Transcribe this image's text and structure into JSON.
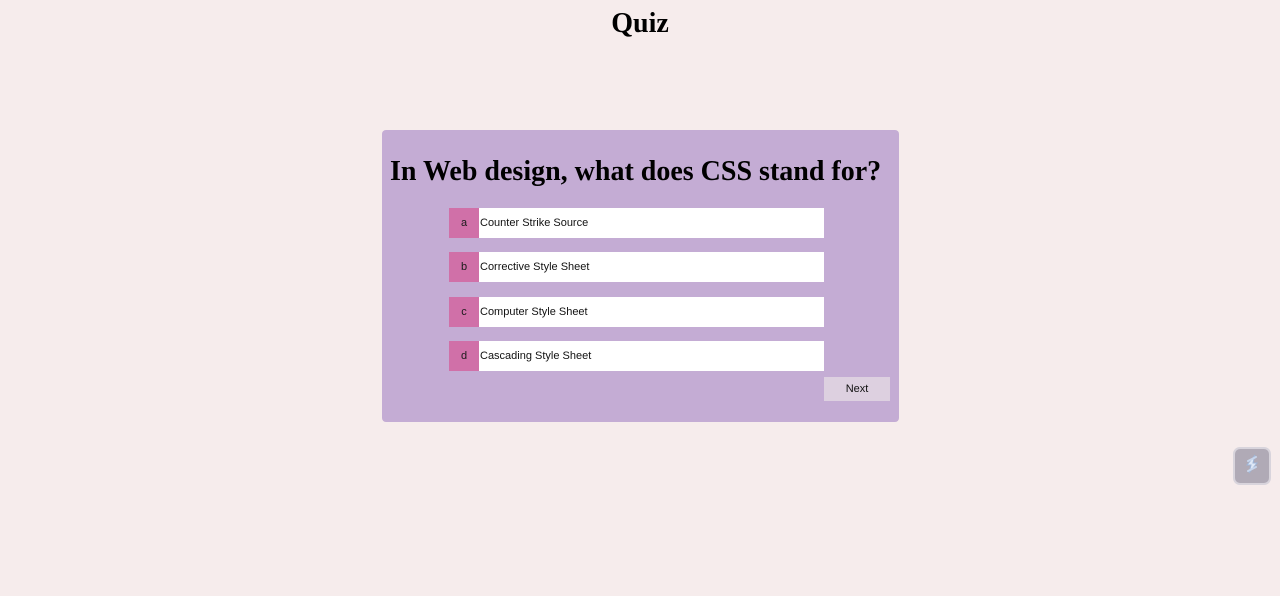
{
  "page": {
    "title": "Quiz"
  },
  "quiz": {
    "question": "In Web design, what does CSS stand for?",
    "options": [
      {
        "letter": "a",
        "text": "Counter Strike Source"
      },
      {
        "letter": "b",
        "text": "Corrective Style Sheet"
      },
      {
        "letter": "c",
        "text": "Computer Style Sheet"
      },
      {
        "letter": "d",
        "text": "Cascading Style Sheet"
      }
    ],
    "next_label": "Next"
  },
  "widget": {
    "icon": "lightning-bolt-icon"
  },
  "colors": {
    "background": "#f6ecec",
    "card": "#c4acd4",
    "option_letter": "#d070a8",
    "option_text_bg": "#ffffff",
    "next_button": "#ddd0e0"
  }
}
